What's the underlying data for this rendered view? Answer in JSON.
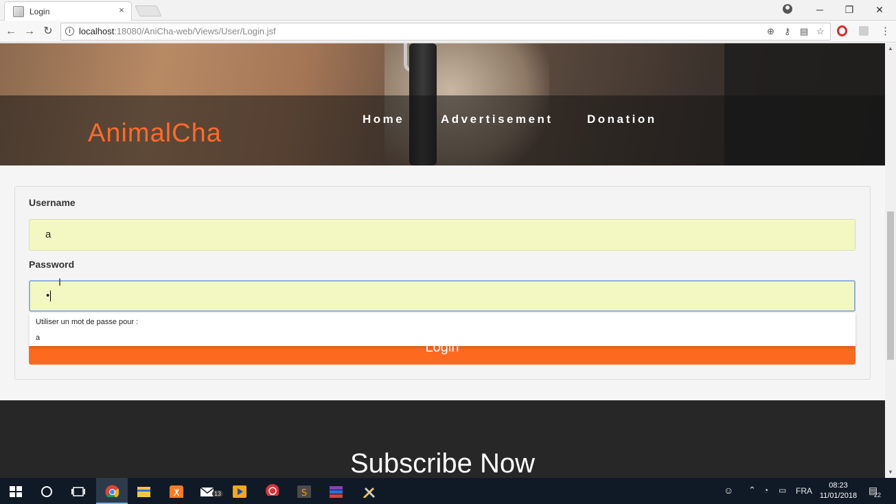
{
  "browser": {
    "tab_title": "Login",
    "tab_close": "×",
    "url_host": "localhost",
    "url_rest": ":18080/AniCha-web/Views/User/Login.jsf",
    "window_controls": {
      "profile": "profile-icon",
      "minimize": "─",
      "restore": "❐",
      "close": "✕"
    },
    "nav": {
      "back": "←",
      "forward": "→",
      "reload": "↻"
    },
    "omni_icons": [
      "zoom-icon",
      "key-icon",
      "translate-icon",
      "star-icon"
    ],
    "extensions": [
      "opera-icon",
      "extension-icon",
      "menu-icon"
    ]
  },
  "site": {
    "brand": "AnimalCha",
    "nav": [
      "Home",
      "Advertisement",
      "Donation"
    ],
    "accent_color": "#fd6a1f"
  },
  "login_form": {
    "username_label": "Username",
    "username_value": "a",
    "password_label": "Password",
    "password_value": "•",
    "login_button": "Login"
  },
  "autocomplete": {
    "title": "Utiliser un mot de passe pour :",
    "item": "a"
  },
  "footer": {
    "subscribe": "Subscribe Now"
  },
  "taskbar": {
    "apps": [
      "windows-start",
      "cortana-search",
      "task-view",
      "chrome",
      "file-explorer",
      "xampp",
      "mail",
      "media-player",
      "app-red",
      "sublime-text",
      "winrar",
      "tools"
    ],
    "mail_badge": "13",
    "language": "FRA",
    "time": "08:23",
    "date": "11/01/2018",
    "notifications": "22"
  }
}
